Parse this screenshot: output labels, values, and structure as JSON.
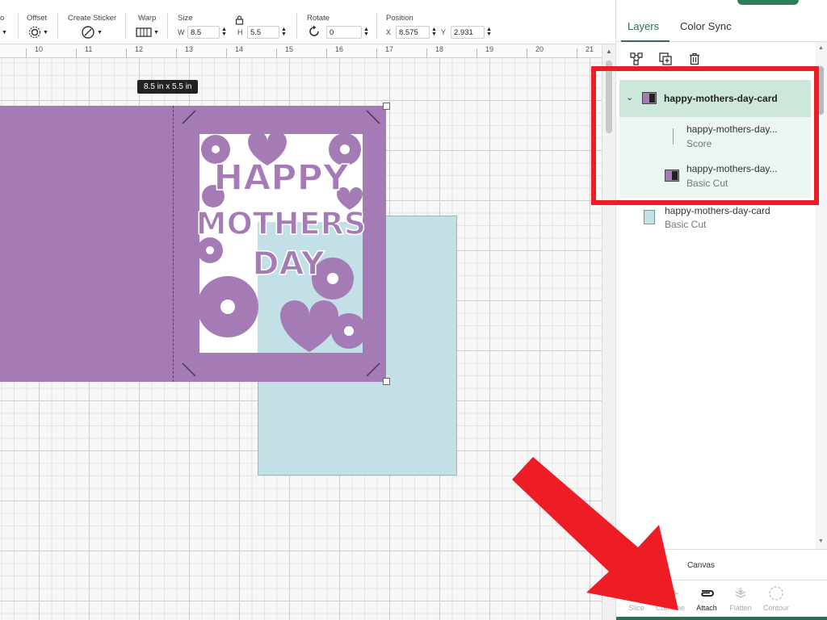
{
  "toolbar": {
    "partial_label": "o",
    "offset_label": "Offset",
    "create_sticker_label": "Create Sticker",
    "warp_label": "Warp",
    "size_label": "Size",
    "width_label": "W",
    "width_value": "8.5",
    "height_label": "H",
    "height_value": "5.5",
    "rotate_label": "Rotate",
    "rotate_value": "0",
    "position_label": "Position",
    "x_label": "X",
    "x_value": "8.575",
    "y_label": "Y",
    "y_value": "2.931"
  },
  "ruler": {
    "ticks": [
      "10",
      "11",
      "12",
      "13",
      "14",
      "15",
      "16",
      "17",
      "18",
      "19",
      "20",
      "21"
    ]
  },
  "canvas": {
    "size_tooltip": "8.5  in x 5.5  in",
    "card_text_lines": [
      "HAPPY",
      "MOTHERS",
      "DAY"
    ],
    "colors": {
      "purple_card": "#a47bb5",
      "blue_card": "#c2e0e6"
    }
  },
  "panel": {
    "tabs": [
      {
        "label": "Layers",
        "active": true
      },
      {
        "label": "Color Sync",
        "active": false
      }
    ],
    "layer_actions": [
      "group-icon",
      "duplicate-icon",
      "delete-icon"
    ],
    "group": {
      "name": "happy-mothers-day-card",
      "expanded": true
    },
    "children": [
      {
        "name": "happy-mothers-day...",
        "operation": "Score"
      },
      {
        "name": "happy-mothers-day...",
        "operation": "Basic Cut"
      }
    ],
    "standalone": {
      "name": "happy-mothers-day-card",
      "operation": "Basic Cut"
    },
    "canvas_label": "Canvas",
    "tools": [
      {
        "label": "Slice",
        "icon": "slice-icon",
        "enabled": false
      },
      {
        "label": "Combine",
        "icon": "combine-icon",
        "enabled": false
      },
      {
        "label": "Attach",
        "icon": "attach-icon",
        "enabled": true
      },
      {
        "label": "Flatten",
        "icon": "flatten-icon",
        "enabled": false
      },
      {
        "label": "Contour",
        "icon": "contour-icon",
        "enabled": false
      }
    ]
  },
  "annotations": {
    "highlight_color": "#ee1c25",
    "arrow_color": "#ee1c25"
  }
}
